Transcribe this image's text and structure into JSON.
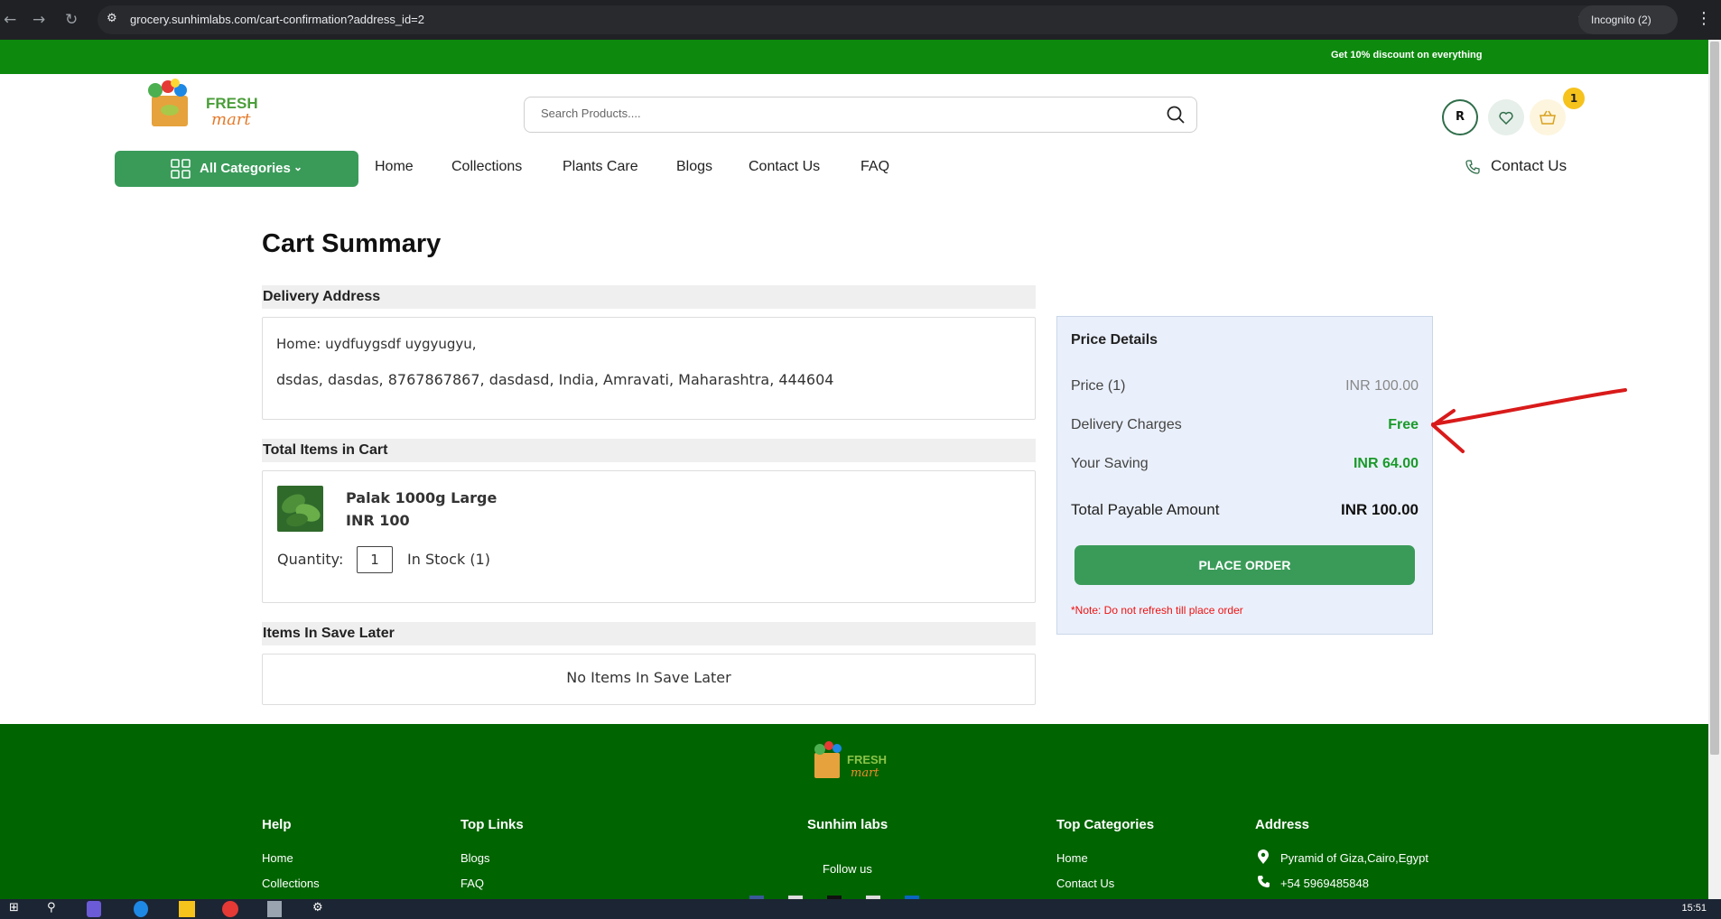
{
  "browser": {
    "url": "grocery.sunhimlabs.com/cart-confirmation?address_id=2",
    "incognito_label": "Incognito (2)"
  },
  "promo": {
    "text": "Get 10% discount on everything"
  },
  "header": {
    "search_placeholder": "Search Products....",
    "avatar_initial": "R",
    "cart_count": "1"
  },
  "nav": {
    "all_categories": "All Categories",
    "links": [
      "Home",
      "Collections",
      "Plants Care",
      "Blogs",
      "Contact Us",
      "FAQ"
    ],
    "contact": "Contact Us"
  },
  "page": {
    "title": "Cart Summary",
    "delivery_heading": "Delivery Address",
    "address_line1": "Home: uydfuygsdf uygyugyu,",
    "address_line2": "dsdas, dasdas, 8767867867, dasdasd, India, Amravati, Maharashtra, 444604",
    "items_heading": "Total Items in Cart",
    "product": {
      "name": "Palak 1000g Large",
      "price": "INR 100",
      "quantity_label": "Quantity:",
      "quantity": "1",
      "stock": "In Stock (1)"
    },
    "save_later_heading": "Items In Save Later",
    "save_later_empty": "No Items In Save Later"
  },
  "price_details": {
    "title": "Price Details",
    "price_label": "Price  (1)",
    "price_value": "INR  100.00",
    "delivery_label": "Delivery Charges",
    "delivery_value": "Free",
    "saving_label": "Your Saving",
    "saving_value": "INR  64.00",
    "total_label": "Total Payable Amount",
    "total_value": "INR  100.00",
    "button": "PLACE ORDER",
    "note": "*Note: Do not refresh till place order"
  },
  "footer": {
    "help": {
      "heading": "Help",
      "links": [
        "Home",
        "Collections"
      ]
    },
    "top_links": {
      "heading": "Top Links",
      "links": [
        "Blogs",
        "FAQ"
      ]
    },
    "brand": {
      "heading": "Sunhim labs",
      "follow": "Follow us"
    },
    "top_categories": {
      "heading": "Top Categories",
      "links": [
        "Home",
        "Contact Us"
      ]
    },
    "address": {
      "heading": "Address",
      "location": "Pyramid of Giza,Cairo,Egypt",
      "phone": "+54 5969485848"
    }
  },
  "taskbar": {
    "clock": "15:51"
  },
  "colors": {
    "primary_green": "#3a9b59",
    "promo_green": "#0d8a0d",
    "footer_green": "#006400",
    "free_green": "#1a9a2a",
    "note_red": "#e11111"
  }
}
